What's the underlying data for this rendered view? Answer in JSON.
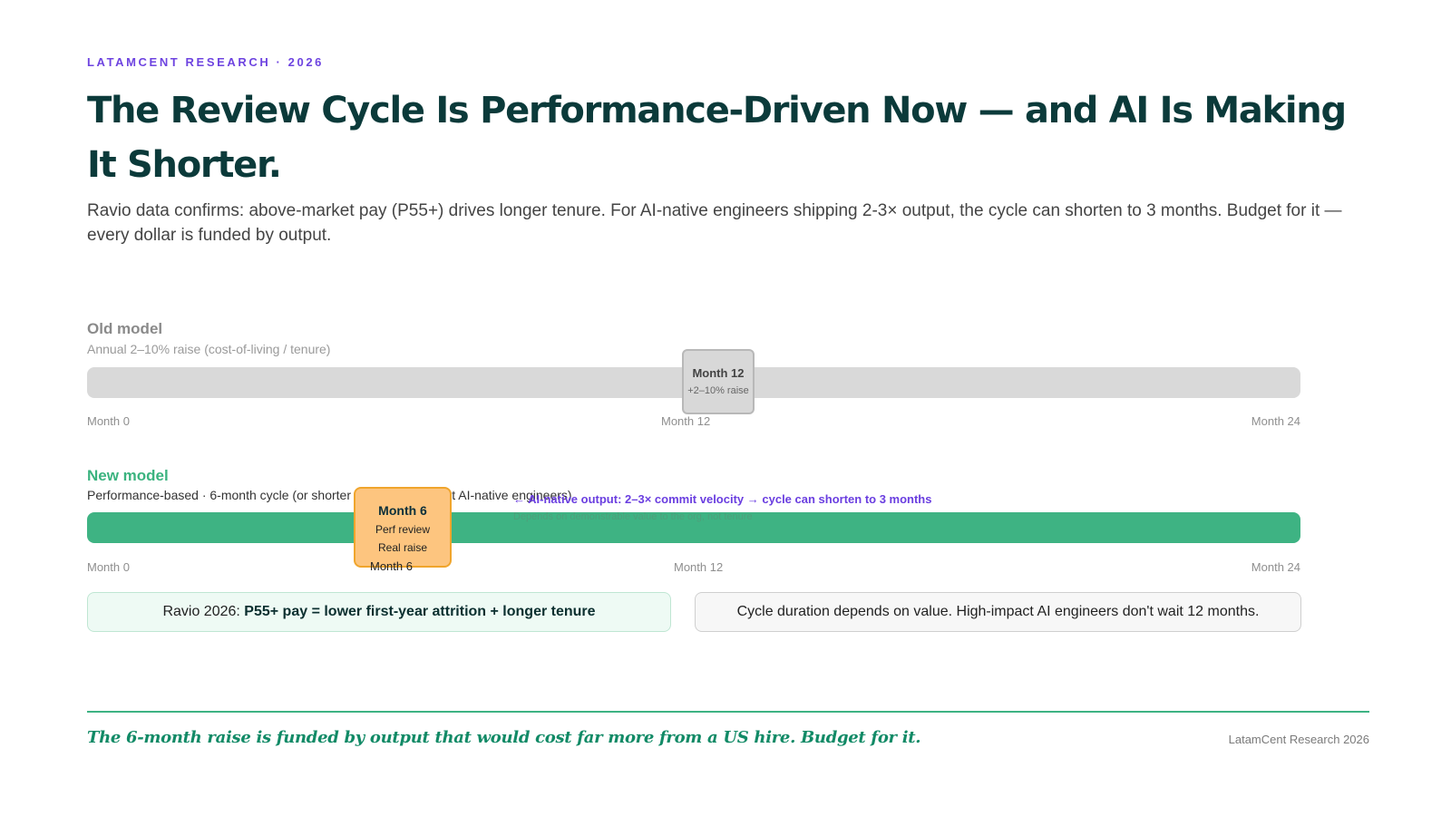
{
  "header": {
    "eyebrow": "LATAMCENT RESEARCH · 2026",
    "title": "The Review Cycle Is Performance-Driven Now — and AI Is Making It Shorter.",
    "subtitle": "Ravio data confirms: above-market pay (P55+) drives longer tenure. For AI-native engineers shipping 2-3× output, the cycle can shorten to 3 months. Budget for it — every dollar is funded by output."
  },
  "timeline": {
    "total_months": 24,
    "old_model": {
      "label": "Old model",
      "sublabel": "Annual 2–10% raise (cost-of-living / tenure)",
      "bar_color": "#d9d9d9",
      "ticks": [
        {
          "month": 0,
          "label": "Month 0"
        },
        {
          "month": 12,
          "label": "Month 12"
        },
        {
          "month": 24,
          "label": "Month 24"
        }
      ],
      "marker": {
        "month": 12,
        "title": "Month 12",
        "subtitle": "+2–10% raise"
      }
    },
    "new_model": {
      "label": "New model",
      "sublabel": "Performance-based · 6-month cycle (or shorter for highest-impact AI-native engineers)",
      "bar_color": "#3eb383",
      "ticks": [
        {
          "month": 0,
          "label": "Month 0"
        },
        {
          "month": 12,
          "label": "Month 12"
        },
        {
          "month": 24,
          "label": "Month 24"
        }
      ],
      "marker": {
        "month": 6,
        "title": "Month 6",
        "line1": "Perf review",
        "line2": "Real raise",
        "tick_label": "Month 6"
      },
      "annotation": "← AI-native output: 2–3× commit velocity → cycle can shorten to 3 months",
      "annotation_sub": "Depends on demonstrable value to the org, not tenure"
    }
  },
  "boxes": {
    "left_prefix": "Ravio 2026: ",
    "left_bold": "P55+ pay = lower first-year attrition + longer tenure",
    "right": "Cycle duration depends on value. High-impact AI engineers don't wait 12 months."
  },
  "footer": {
    "quote": "The 6-month raise is funded by output that would cost far more from a US hire. Budget for it.",
    "credit": "LatamCent Research 2026"
  },
  "colors": {
    "accent_purple": "#6e44e0",
    "title_teal": "#0b3a3a",
    "green": "#3eb383",
    "amber": "#fdc57f"
  }
}
